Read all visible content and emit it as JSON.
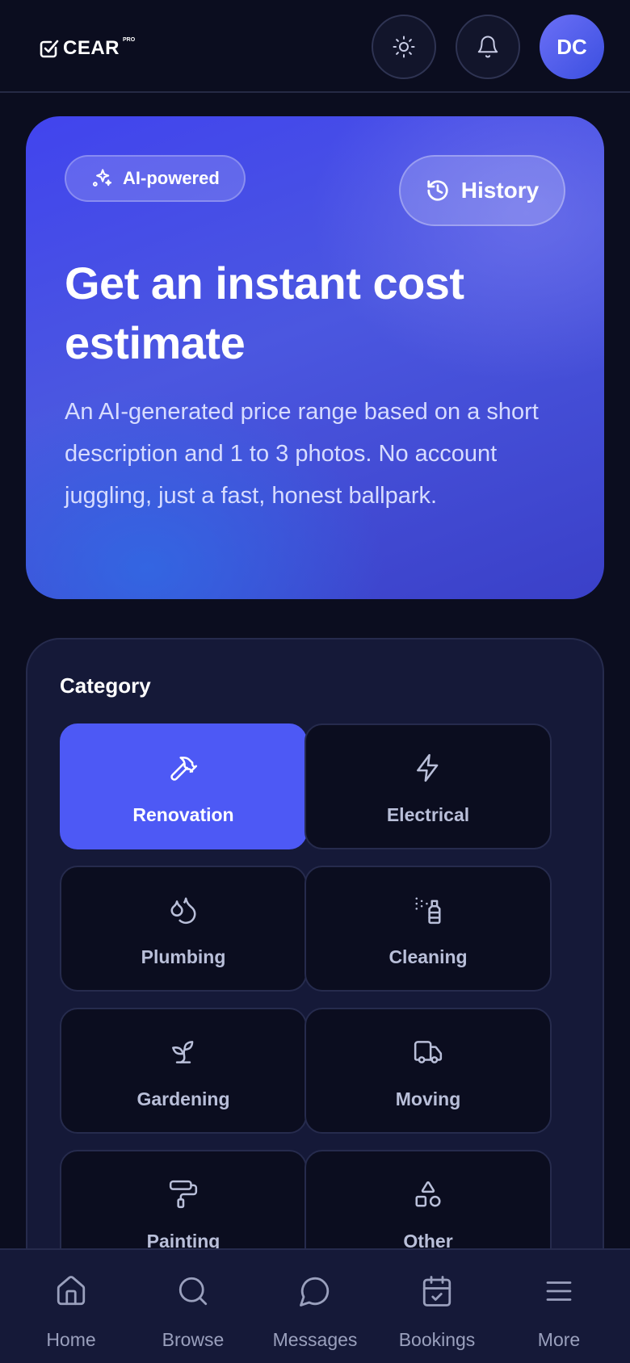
{
  "header": {
    "logo_text": "CEAR",
    "logo_sup": "PRO",
    "avatar_initials": "DC",
    "icons": [
      "check-badge-icon",
      "sun-icon",
      "bell-icon"
    ]
  },
  "hero": {
    "badge_label": "AI-powered",
    "history_label": "History",
    "title": "Get an instant cost estimate",
    "description": "An AI-generated price range based on a short description and 1 to 3 photos. No account juggling, just a fast, honest ballpark."
  },
  "category": {
    "title": "Category",
    "selected": "Renovation",
    "items": [
      {
        "label": "Renovation",
        "icon": "hammer-icon"
      },
      {
        "label": "Electrical",
        "icon": "lightning-icon"
      },
      {
        "label": "Plumbing",
        "icon": "droplets-icon"
      },
      {
        "label": "Cleaning",
        "icon": "spray-bottle-icon"
      },
      {
        "label": "Gardening",
        "icon": "sprout-icon"
      },
      {
        "label": "Moving",
        "icon": "truck-icon"
      },
      {
        "label": "Painting",
        "icon": "paint-roller-icon"
      },
      {
        "label": "Other",
        "icon": "shapes-icon"
      }
    ]
  },
  "nav": {
    "items": [
      {
        "label": "Home",
        "icon": "home-icon"
      },
      {
        "label": "Browse",
        "icon": "search-icon"
      },
      {
        "label": "Messages",
        "icon": "chat-icon"
      },
      {
        "label": "Bookings",
        "icon": "calendar-check-icon"
      },
      {
        "label": "More",
        "icon": "menu-icon"
      }
    ]
  },
  "colors": {
    "background": "#0b0d1f",
    "accent": "#4d59f5",
    "card": "#151938"
  }
}
